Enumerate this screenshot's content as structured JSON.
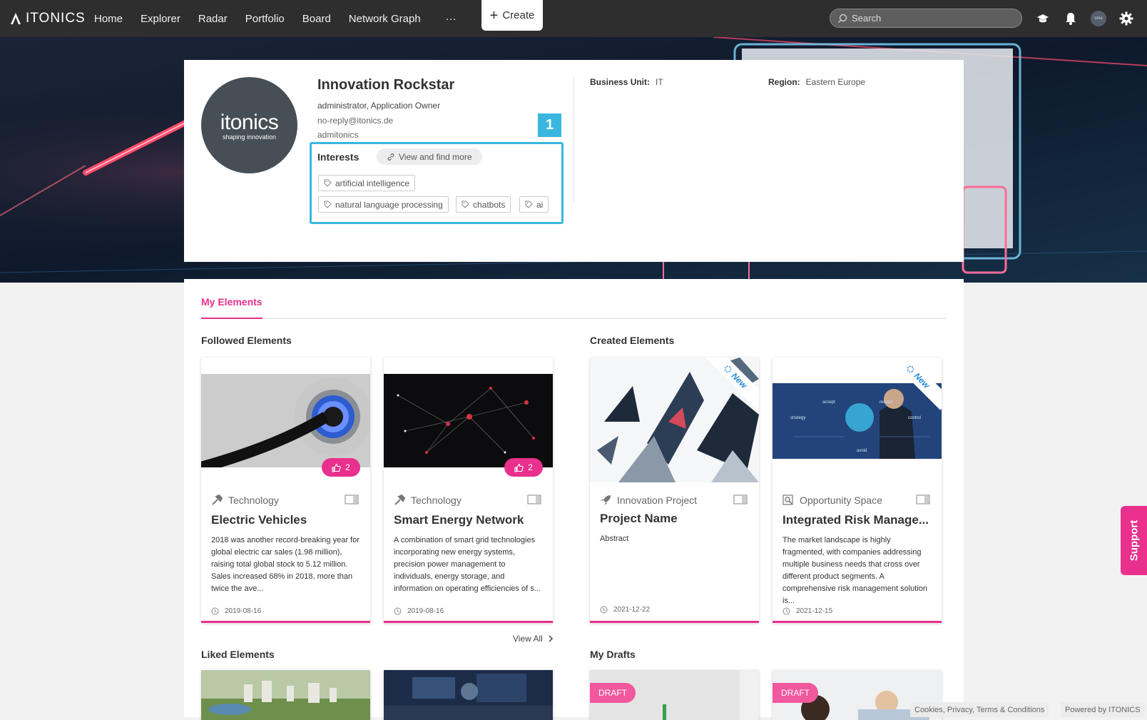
{
  "app": {
    "name": "ITONICS"
  },
  "nav": {
    "items": [
      "Home",
      "Explorer",
      "Radar",
      "Portfolio",
      "Board",
      "Network Graph"
    ],
    "more": "···",
    "create_label": "Create"
  },
  "search": {
    "placeholder": "Search"
  },
  "user": {
    "avatar_initials": "sma"
  },
  "profile": {
    "name": "Innovation Rockstar",
    "roles": "administrator, Application Owner",
    "email": "no-reply@itonics.de",
    "username": "admitonics",
    "avatar_logo": "itonics",
    "avatar_tagline": "shaping innovation",
    "business_unit_label": "Business Unit:",
    "business_unit": "IT",
    "region_label": "Region:",
    "region": "Eastern Europe",
    "interests_title": "Interests",
    "view_more": "View and find more",
    "tags": [
      "artificial intelligence",
      "natural language processing",
      "chatbots",
      "ai"
    ]
  },
  "annotation": {
    "marker": "1",
    "color": "#3ab6e0"
  },
  "tabs": {
    "my_elements": "My Elements"
  },
  "sections": {
    "followed": "Followed Elements",
    "created": "Created Elements",
    "liked": "Liked Elements",
    "drafts": "My Drafts",
    "view_all": "View All"
  },
  "cards": [
    {
      "type": "Technology",
      "title": "Electric Vehicles",
      "likes": "2",
      "date": "2019-08-16",
      "desc": "2018 was another record-breaking year for global electric car sales (1.98 million), raising total global stock to 5.12 million. Sales increased 68% in 2018, more than twice the ave...",
      "icon": "hammer-icon"
    },
    {
      "type": "Technology",
      "title": "Smart Energy Network",
      "likes": "2",
      "date": "2019-08-16",
      "desc": "A combination of smart grid technologies incorporating new energy systems, precision power management to individuals, energy storage, and information on operating efficiencies of s...",
      "icon": "hammer-icon"
    },
    {
      "type": "Innovation Project",
      "title": "Project Name",
      "date": "2021-12-22",
      "desc": "Abstract",
      "badge": "New",
      "icon": "rocket-icon"
    },
    {
      "type": "Opportunity Space",
      "title": "Integrated Risk Manage...",
      "date": "2021-12-15",
      "desc": "The market landscape is highly fragmented, with companies addressing multiple business needs that cross over different product segments. A comprehensive risk management solution is...",
      "badge": "New",
      "icon": "magnifier-icon"
    }
  ],
  "drafts": {
    "label": "DRAFT"
  },
  "support": "Support",
  "footer": {
    "legal": "Cookies, Privacy, Terms & Conditions",
    "powered": "Powered by ITONICS"
  },
  "colors": {
    "accent": "#e8308c",
    "topbar": "#2e2e2e",
    "highlight": "#3ab6e0"
  }
}
